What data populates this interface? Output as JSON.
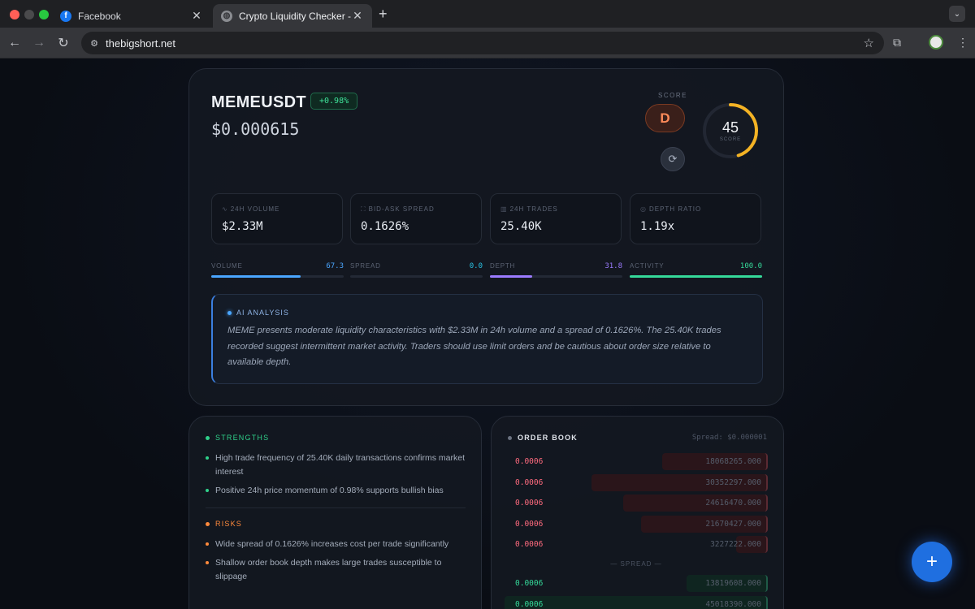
{
  "browser": {
    "tabs": [
      {
        "title": "Facebook",
        "icon": "facebook-icon"
      },
      {
        "title": "Crypto Liquidity Checker - TB",
        "icon": "globe-icon"
      }
    ],
    "url": "thebigshort.net"
  },
  "header": {
    "symbol": "MEMEUSDT",
    "change": "+0.98%",
    "price": "$0.000615",
    "score_label": "SCORE",
    "grade": "D",
    "score": "45",
    "score_sub": "SCORE",
    "score_fraction": 0.45
  },
  "metrics": [
    {
      "label": "24H VOLUME",
      "value": "$2.33M",
      "icon": "pulse-icon"
    },
    {
      "label": "BID-ASK SPREAD",
      "value": "0.1626%",
      "icon": "expand-icon"
    },
    {
      "label": "24H TRADES",
      "value": "25.40K",
      "icon": "bar-chart-icon"
    },
    {
      "label": "DEPTH RATIO",
      "value": "1.19x",
      "icon": "target-icon"
    }
  ],
  "bars": [
    {
      "label": "VOLUME",
      "value": "67.3",
      "level": 67.3,
      "color": "#4aa6ff"
    },
    {
      "label": "SPREAD",
      "value": "0.0",
      "level": 0.0,
      "color": "#29c5e6"
    },
    {
      "label": "DEPTH",
      "value": "31.8",
      "level": 31.8,
      "color": "#9b7bff"
    },
    {
      "label": "ACTIVITY",
      "value": "100.0",
      "level": 100.0,
      "color": "#35d99a"
    }
  ],
  "ai": {
    "title": "AI ANALYSIS",
    "text": "MEME presents moderate liquidity characteristics with $2.33M in 24h volume and a spread of 0.1626%. The 25.40K trades recorded suggest intermittent market activity. Traders should use limit orders and be cautious about order size relative to available depth."
  },
  "strengths": {
    "title": "STRENGTHS",
    "items": [
      "High trade frequency of 25.40K daily transactions confirms market interest",
      "Positive 24h price momentum of 0.98% supports bullish bias"
    ]
  },
  "risks": {
    "title": "RISKS",
    "items": [
      "Wide spread of 0.1626% increases cost per trade significantly",
      "Shallow order book depth makes large trades susceptible to slippage"
    ]
  },
  "orderbook": {
    "title": "ORDER BOOK",
    "spread": "Spread: $0.000001",
    "separator": "— SPREAD —",
    "asks": [
      {
        "price": "0.0006",
        "qty": "18068265.000",
        "depth": 0.4
      },
      {
        "price": "0.0006",
        "qty": "30352297.000",
        "depth": 0.67
      },
      {
        "price": "0.0006",
        "qty": "24616470.000",
        "depth": 0.55
      },
      {
        "price": "0.0006",
        "qty": "21670427.000",
        "depth": 0.48
      },
      {
        "price": "0.0006",
        "qty": "3227222.000",
        "depth": 0.12
      }
    ],
    "bids": [
      {
        "price": "0.0006",
        "qty": "13819608.000",
        "depth": 0.31
      },
      {
        "price": "0.0006",
        "qty": "45018390.000",
        "depth": 1.0
      }
    ]
  },
  "colors": {
    "accent": "#1f6fe0",
    "positive": "#35d99a",
    "negative": "#ff6b7e",
    "strength": "#2fd08a",
    "risk": "#ff8a3c",
    "gauge": "#f4b324"
  }
}
